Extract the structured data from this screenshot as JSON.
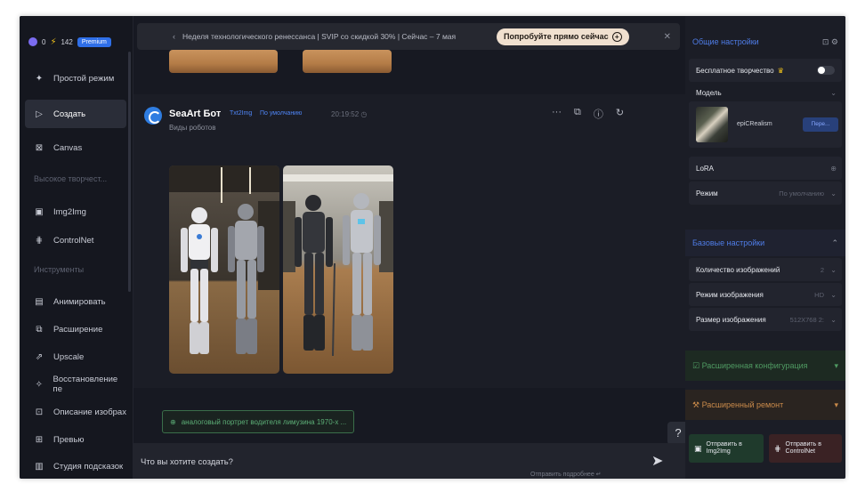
{
  "sidebar": {
    "top": {
      "coins": "0",
      "energy": "142",
      "premium": "Premium"
    },
    "items": [
      {
        "label": "Простой режим",
        "icon": "sparkle-icon",
        "active": false
      },
      {
        "label": "Создать",
        "icon": "play-icon",
        "active": true
      },
      {
        "label": "Canvas",
        "icon": "canvas-icon",
        "active": false
      }
    ],
    "section_high": "Высокое творчест...",
    "high_items": [
      {
        "label": "Img2Img",
        "icon": "image-icon"
      },
      {
        "label": "ControlNet",
        "icon": "controlnet-icon"
      }
    ],
    "section_tools": "Инструменты",
    "tool_items": [
      {
        "label": "Анимировать",
        "icon": "film-icon"
      },
      {
        "label": "Расширение",
        "icon": "expand-icon"
      },
      {
        "label": "Upscale",
        "icon": "upscale-icon"
      },
      {
        "label": "Восстановление пе",
        "icon": "magic-wand-icon"
      },
      {
        "label": "Описание изобрах",
        "icon": "describe-icon"
      },
      {
        "label": "Превью",
        "icon": "preview-icon"
      },
      {
        "label": "Студия подсказок",
        "icon": "studio-icon"
      }
    ]
  },
  "banner": {
    "text": "Неделя технологического ренессанса | SVIP со скидкой 30% | Сейчас – 7 мая",
    "button": "Попробуйте прямо сейчас"
  },
  "message": {
    "bot_name": "SeaArt Бот",
    "tag1": "Txt2Img",
    "tag2": "По умолчанию",
    "time": "20:19:52",
    "description": "Виды роботов"
  },
  "prompt_chip": "аналоговый портрет водителя лимузина 1970-х ...",
  "help": "?",
  "input": {
    "placeholder": "Что вы хотите создать?",
    "hint": "Отправить подробнее ↵"
  },
  "right_panel": {
    "general_header": "Общие настройки",
    "free_creativity": "Бесплатное творчество",
    "model_label": "Модель",
    "model_name": "epiCRealism",
    "model_button": "Пере...",
    "lora_label": "LoRA",
    "mode_label": "Режим",
    "mode_value": "По умолчанию",
    "base_header": "Базовые настройки",
    "count_label": "Количество изображений",
    "count_value": "2",
    "image_mode_label": "Режим изображения",
    "image_mode_value": "HD",
    "size_label": "Размер изображения",
    "size_value": "512X768",
    "size_ratio": "2:",
    "ext_config_header": "Расширенная конфигурация",
    "ext_repair_header": "Расширенный ремонт",
    "send_img2img": "Отправить в Img2Img",
    "send_controlnet": "Отправить в ControlNet"
  },
  "colors": {
    "accent_blue": "#4f7de8",
    "green": "#5cae76",
    "orange": "#c98a4a",
    "premium": "#2f6fe8"
  }
}
